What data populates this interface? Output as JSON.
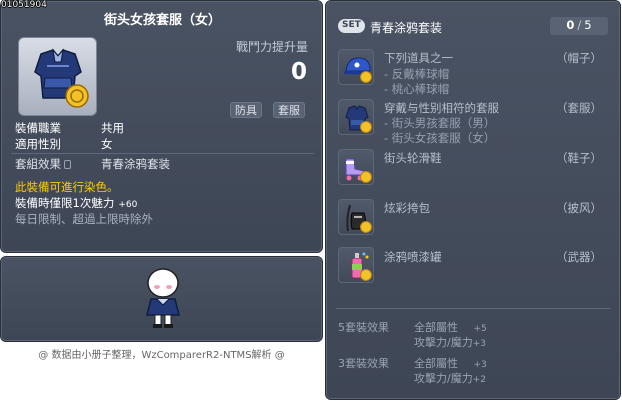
{
  "item_id": "01051904",
  "tooltip": {
    "title": "街头女孩套服（女）",
    "power_label": "戰鬥力提升量",
    "power_value": "0",
    "tags": [
      "防具",
      "套服"
    ],
    "job_key": "裝備職業",
    "job_value": "共用",
    "gender_key": "適用性別",
    "gender_value": "女",
    "set_key": "套組效果",
    "set_value": "青春涂鸦套装",
    "dye_text": "此裝備可進行染色。",
    "charm_label": "裝備時僅限1次魅力",
    "charm_value": "+60",
    "limit_text": "每日限制、超過上限時除外"
  },
  "footer": "@ 数据由小册子整理，WzComparerR2-NTMS解析 @",
  "set_panel": {
    "badge": "SET",
    "name": "青春涂鸦套装",
    "count": "0",
    "total": "5",
    "items": [
      {
        "name": "下列道具之一",
        "subs": [
          "- 反戴棒球帽",
          "- 桃心棒球帽"
        ],
        "category": "（帽子）"
      },
      {
        "name": "穿戴与性别相符的套服",
        "subs": [
          "- 街头男孩套服（男）",
          "- 街头女孩套服（女）"
        ],
        "category": "（套服）"
      },
      {
        "name": "街头轮滑鞋",
        "subs": [],
        "category": "（鞋子）"
      },
      {
        "name": "炫彩挎包",
        "subs": [],
        "category": "（披风）"
      },
      {
        "name": "涂鸦喷漆罐",
        "subs": [],
        "category": "（武器）"
      }
    ],
    "bonuses": [
      {
        "label": "5套裝效果",
        "line1": "全部屬性",
        "v1": "+5",
        "line2": "攻擊力/魔力",
        "v2": "+3"
      },
      {
        "label": "3套裝效果",
        "line1": "全部屬性",
        "v1": "+3",
        "line2": "攻擊力/魔力",
        "v2": "+2"
      }
    ]
  },
  "colors": {
    "panel_bg": "#4a5363",
    "dye_yellow": "#ffcc00",
    "coin_gold": "#f2c22a"
  }
}
